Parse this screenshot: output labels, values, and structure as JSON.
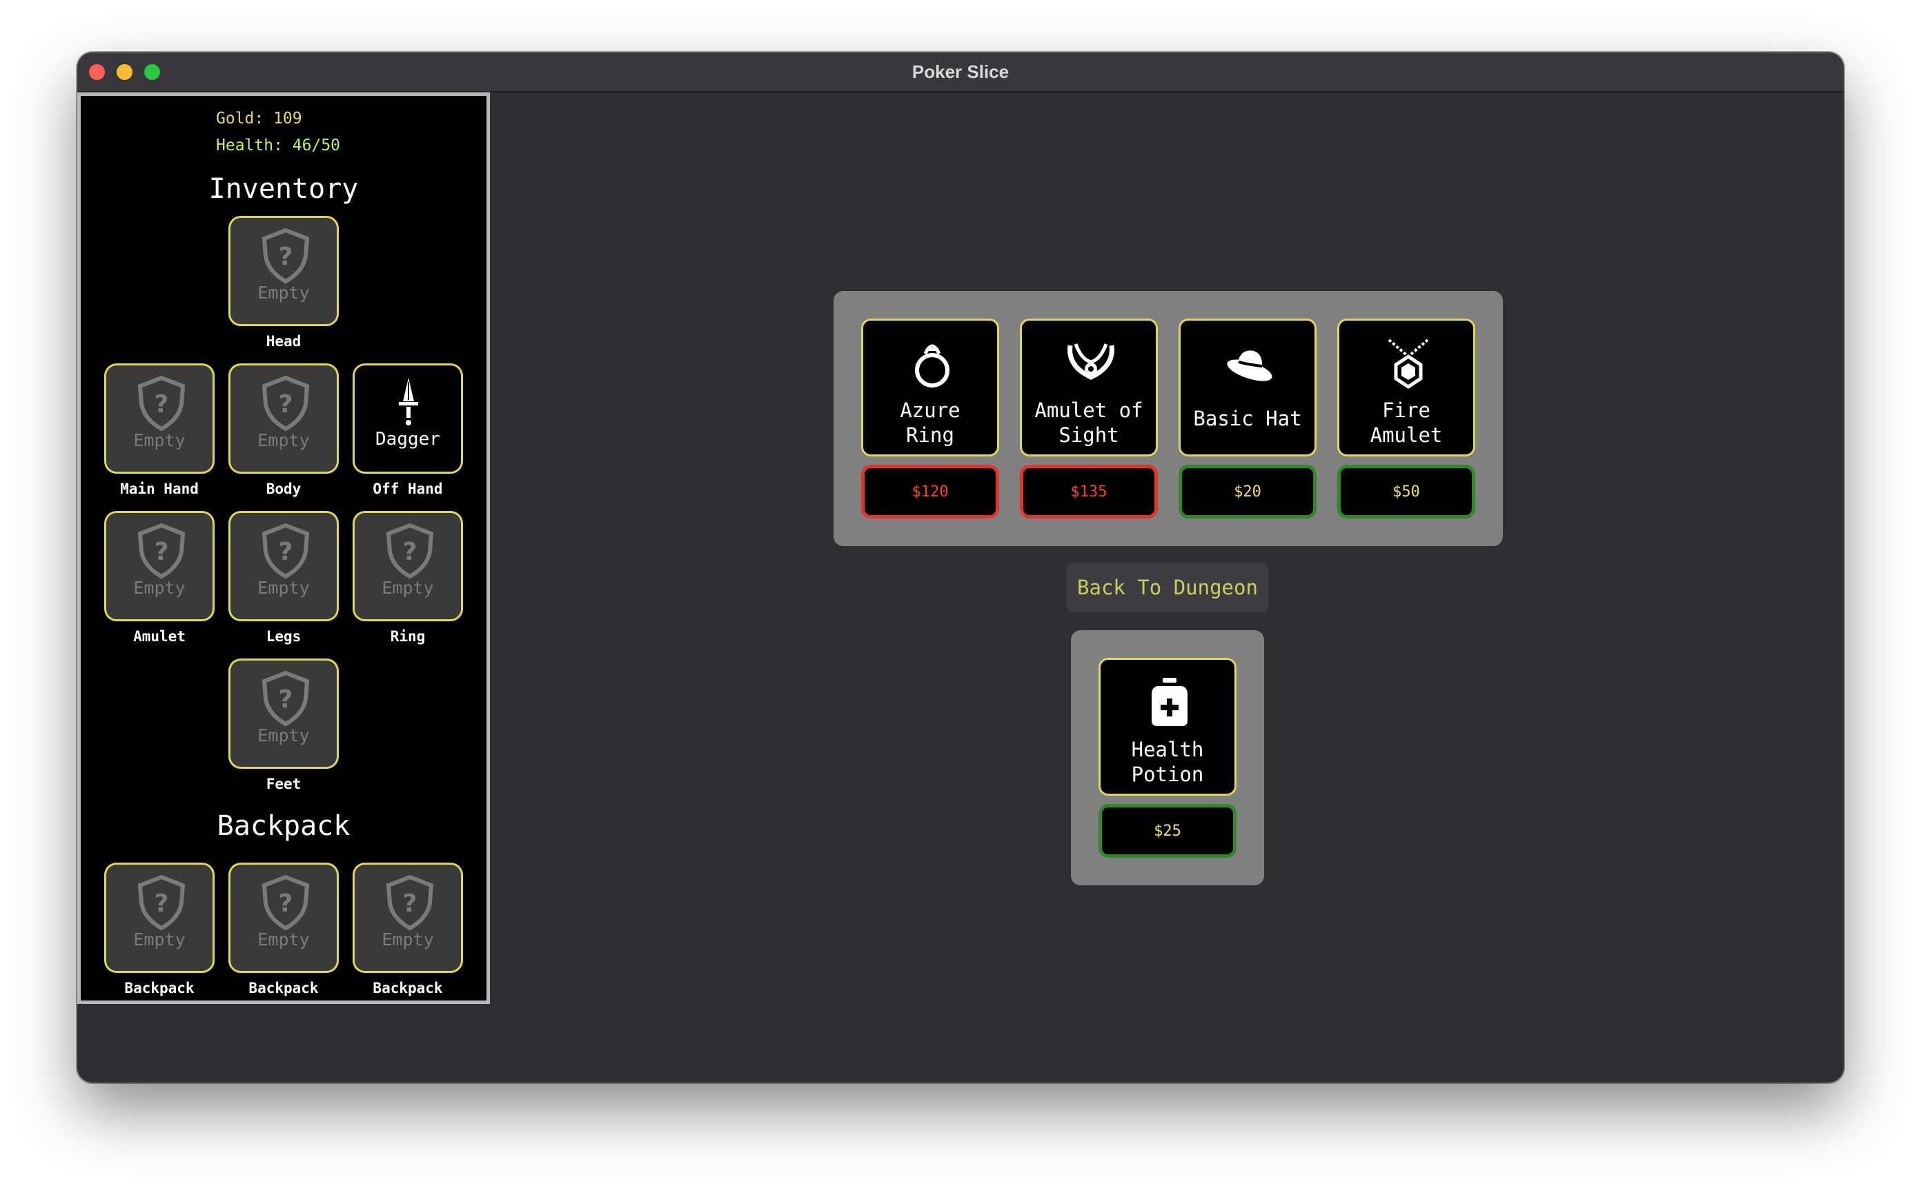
{
  "window": {
    "title": "Poker Slice"
  },
  "stats": {
    "gold": "Gold: 109",
    "health": "Health: 46/50"
  },
  "inventory": {
    "heading": "Inventory",
    "slots": [
      {
        "label": "Head",
        "item": "Empty"
      },
      {
        "label": "Main Hand",
        "item": "Empty"
      },
      {
        "label": "Body",
        "item": "Empty"
      },
      {
        "label": "Off Hand",
        "item": "Dagger"
      },
      {
        "label": "Amulet",
        "item": "Empty"
      },
      {
        "label": "Legs",
        "item": "Empty"
      },
      {
        "label": "Ring",
        "item": "Empty"
      },
      {
        "label": "Feet",
        "item": "Empty"
      }
    ]
  },
  "backpack": {
    "heading": "Backpack",
    "slots": [
      {
        "label": "Backpack",
        "item": "Empty"
      },
      {
        "label": "Backpack",
        "item": "Empty"
      },
      {
        "label": "Backpack",
        "item": "Empty"
      }
    ]
  },
  "shop": {
    "items": [
      {
        "name_line1": "Azure",
        "name_line2": "Ring",
        "price": "$120",
        "affordable": false,
        "icon": "ring-icon"
      },
      {
        "name_line1": "Amulet of",
        "name_line2": "Sight",
        "price": "$135",
        "affordable": false,
        "icon": "amulet-icon"
      },
      {
        "name_line1": "Basic Hat",
        "name_line2": "",
        "price": "$20",
        "affordable": true,
        "icon": "hat-icon"
      },
      {
        "name_line1": "Fire",
        "name_line2": "Amulet",
        "price": "$50",
        "affordable": true,
        "icon": "necklace-icon"
      }
    ],
    "consumables": [
      {
        "name_line1": "Health",
        "name_line2": "Potion",
        "price": "$25",
        "affordable": true,
        "icon": "potion-icon"
      }
    ]
  },
  "actions": {
    "back_label": "Back To Dungeon"
  },
  "colors": {
    "slot_border": "#e2d84b",
    "price_unaffordable": "#e0352b",
    "price_affordable": "#2e8b24",
    "gold_text": "#e9dd4f",
    "health_text": "#c6f05a"
  }
}
